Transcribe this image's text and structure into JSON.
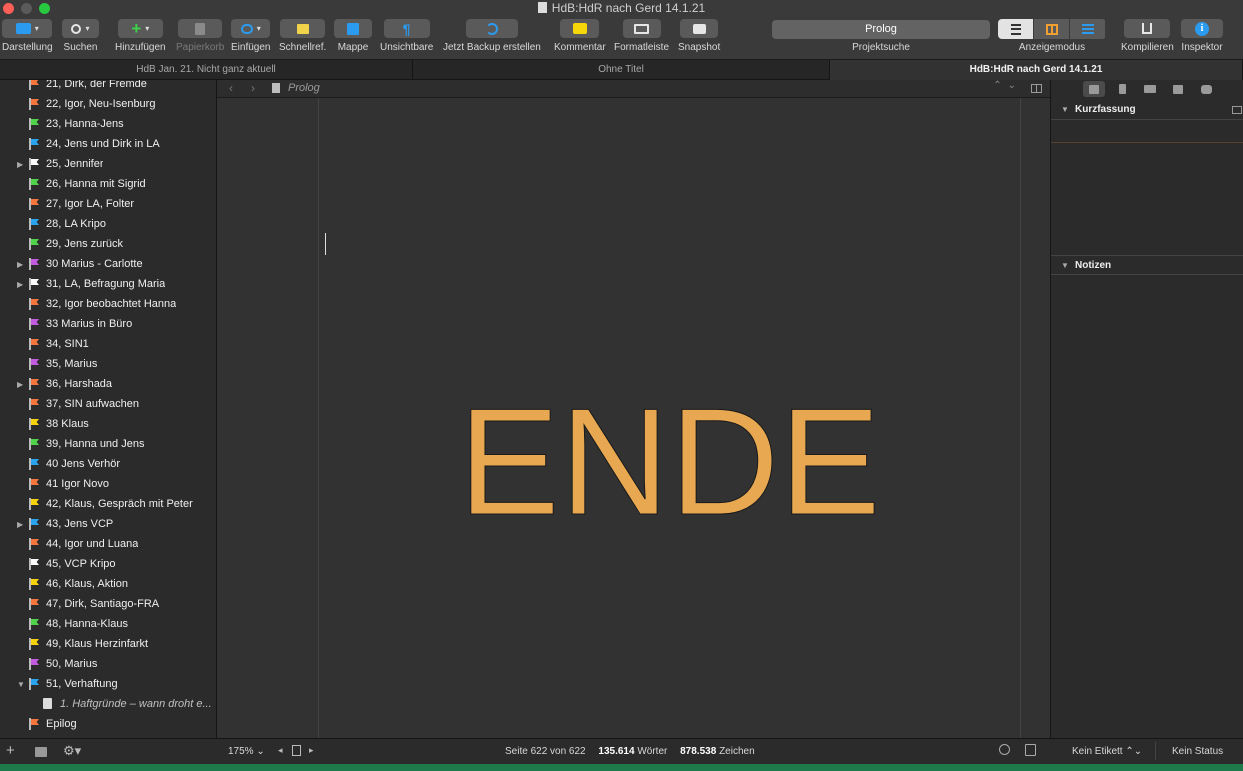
{
  "window": {
    "title": "HdB:HdR nach Gerd  14.1.21"
  },
  "toolbar": {
    "darstellung": "Darstellung",
    "suchen": "Suchen",
    "hinzufuegen": "Hinzufügen",
    "papierkorb": "Papierkorb",
    "einfuegen": "Einfügen",
    "schnellref": "Schnellref.",
    "mappe": "Mappe",
    "unsichtbare": "Unsichtbare",
    "backup": "Jetzt Backup erstellen",
    "kommentar": "Kommentar",
    "formatleiste": "Formatleiste",
    "snapshot": "Snapshot",
    "projektsuche_value": "Prolog",
    "projektsuche_label": "Projektsuche",
    "anzeigemodus": "Anzeigemodus",
    "kompilieren": "Kompilieren",
    "inspektor": "Inspektor"
  },
  "tabs": [
    {
      "label": "HdB Jan. 21. Nicht ganz aktuell",
      "active": false
    },
    {
      "label": "Ohne Titel",
      "active": false
    },
    {
      "label": "HdB:HdR nach Gerd  14.1.21",
      "active": true
    }
  ],
  "binder": {
    "items": [
      {
        "label": "21, Dirk, der Fremde",
        "flag": "#f4763c",
        "expandable": false
      },
      {
        "label": "22, Igor, Neu-Isenburg",
        "flag": "#f4763c",
        "expandable": false
      },
      {
        "label": "23, Hanna-Jens",
        "flag": "#52d14b",
        "expandable": false
      },
      {
        "label": "24, Jens und Dirk in LA",
        "flag": "#2ba4f0",
        "expandable": false
      },
      {
        "label": "25, Jennifer",
        "flag": "#ffffff",
        "expandable": true
      },
      {
        "label": "26, Hanna mit Sigrid",
        "flag": "#52d14b",
        "expandable": false
      },
      {
        "label": "27,  Igor LA, Folter",
        "flag": "#f4763c",
        "expandable": false
      },
      {
        "label": "28, LA Kripo",
        "flag": "#2ba4f0",
        "expandable": false
      },
      {
        "label": "29, Jens zurück",
        "flag": "#52d14b",
        "expandable": false
      },
      {
        "label": "30  Marius - Carlotte",
        "flag": "#c25be0",
        "expandable": true
      },
      {
        "label": "31, LA, Befragung Maria",
        "flag": "#ffffff",
        "expandable": true
      },
      {
        "label": "32, Igor beobachtet Hanna",
        "flag": "#f4763c",
        "expandable": false
      },
      {
        "label": "33 Marius in Büro",
        "flag": "#c25be0",
        "expandable": false
      },
      {
        "label": "34, SIN1",
        "flag": "#f4763c",
        "expandable": false
      },
      {
        "label": "35, Marius",
        "flag": "#c25be0",
        "expandable": false
      },
      {
        "label": "36, Harshada",
        "flag": "#f4763c",
        "expandable": true
      },
      {
        "label": "37, SIN aufwachen",
        "flag": "#f4763c",
        "expandable": false
      },
      {
        "label": "38 Klaus",
        "flag": "#f5d20a",
        "expandable": false
      },
      {
        "label": "39, Hanna und Jens",
        "flag": "#52d14b",
        "expandable": false
      },
      {
        "label": "40 Jens Verhör",
        "flag": "#2ba4f0",
        "expandable": false
      },
      {
        "label": "41  Igor Novo",
        "flag": "#f4763c",
        "expandable": false
      },
      {
        "label": "42, Klaus, Gespräch mit Peter",
        "flag": "#f5d20a",
        "expandable": false
      },
      {
        "label": "43, Jens VCP",
        "flag": "#2ba4f0",
        "expandable": true
      },
      {
        "label": "44, Igor und Luana",
        "flag": "#f4763c",
        "expandable": false
      },
      {
        "label": "45, VCP Kripo",
        "flag": "#ffffff",
        "expandable": false
      },
      {
        "label": "46, Klaus, Aktion",
        "flag": "#f5d20a",
        "expandable": false
      },
      {
        "label": "47, Dirk, Santiago-FRA",
        "flag": "#f4763c",
        "expandable": false
      },
      {
        "label": "48, Hanna-Klaus",
        "flag": "#52d14b",
        "expandable": false
      },
      {
        "label": "49, Klaus Herzinfarkt",
        "flag": "#f5d20a",
        "expandable": false
      },
      {
        "label": "50, Marius",
        "flag": "#c25be0",
        "expandable": false
      },
      {
        "label": "51, Verhaftung",
        "flag": "#2ba4f0",
        "expandable": true,
        "expanded": true
      },
      {
        "label": "1. Haftgründe – wann droht e...",
        "sub": true
      },
      {
        "label": "Epilog",
        "flag": "#f4763c",
        "expandable": false
      }
    ]
  },
  "editor": {
    "breadcrumb": "Prolog",
    "content": "ENDE",
    "content_color": "#e8a851"
  },
  "inspector": {
    "kurzfassung": "Kurzfassung",
    "notizen": "Notizen"
  },
  "footer": {
    "zoom": "175%",
    "page_info": "Seite 622 von 622",
    "word_count": "135.614",
    "words_label": "Wörter",
    "char_count": "878.538",
    "chars_label": "Zeichen",
    "label_select": "Kein Etikett",
    "status_select": "Kein Status"
  }
}
